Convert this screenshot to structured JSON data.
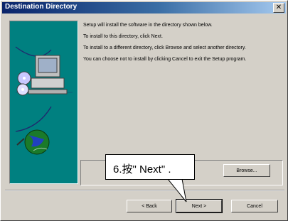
{
  "window": {
    "title": "Destination Directory",
    "close_glyph": "✕"
  },
  "body": {
    "paragraphs": [
      "Setup will install the software in the directory shown below.",
      "To install to this directory, click Next.",
      "To install to a different directory, click Browse and select another directory.",
      "You can choose not to install by clicking Cancel to exit the Setup program."
    ]
  },
  "buttons": {
    "browse": "Browse...",
    "back": "< Back",
    "next": "Next >",
    "cancel": "Cancel"
  },
  "callout": {
    "text": "6.按\" Next\" ."
  },
  "colors": {
    "titlebar": "#0a246a",
    "face": "#d4d0c8",
    "art_bg": "#008080"
  },
  "icons": [
    "computer-icon",
    "cd-disc-icon",
    "globe-icon",
    "close-icon"
  ]
}
